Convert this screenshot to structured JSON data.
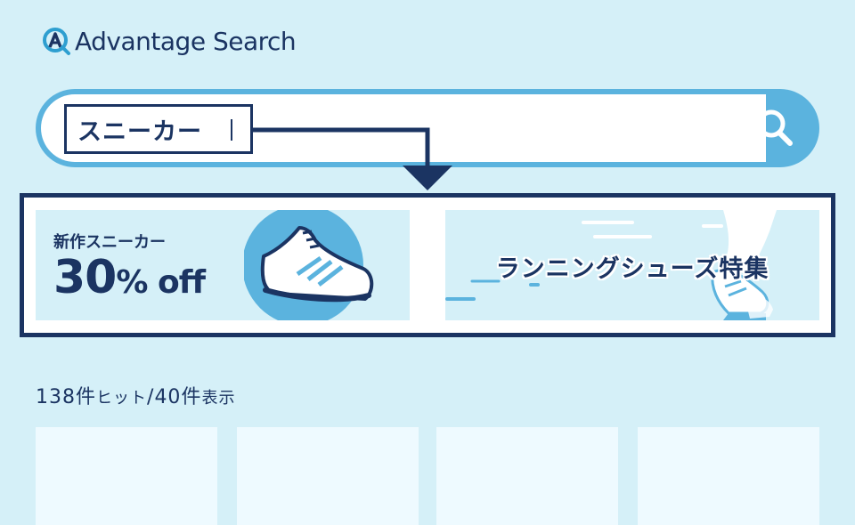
{
  "app": {
    "logo_text": "Advantage Search",
    "logo_icon": "magnifier-logo-icon"
  },
  "search": {
    "query": "スニーカー",
    "button_icon": "search-icon"
  },
  "banners": [
    {
      "subtitle": "新作スニーカー",
      "headline_number": "30",
      "headline_unit": "%",
      "headline_suffix": " off",
      "icon": "sneaker-icon"
    },
    {
      "title": "ランニングシューズ特集",
      "icon": "running-shoe-icon"
    }
  ],
  "results": {
    "total": "138",
    "total_unit": "件",
    "hit_label": "ヒット",
    "separator": "/",
    "shown": "40",
    "shown_unit": "件",
    "shown_label": "表示"
  },
  "colors": {
    "navy": "#1b3462",
    "accent_blue": "#5bb3de",
    "background": "#d5f0f8",
    "card": "#eefaff"
  }
}
